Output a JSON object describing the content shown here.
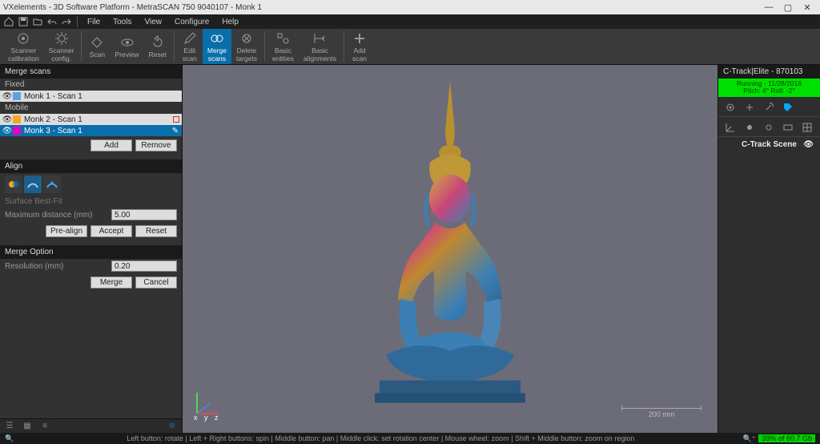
{
  "window": {
    "title": "VXelements - 3D Software Platform - MetraSCAN 750 9040107 - Monk 1",
    "minimize": "—",
    "maximize": "▢",
    "close": "✕"
  },
  "menu": {
    "items": [
      "File",
      "Tools",
      "View",
      "Configure",
      "Help"
    ]
  },
  "ribbon": {
    "scanner_calibration": "Scanner\ncalibration",
    "scanner_config": "Scanner\nconfig.",
    "scan": "Scan",
    "preview": "Preview",
    "reset": "Reset",
    "edit_scan": "Edit\nscan",
    "merge_scans": "Merge\nscans",
    "delete_targets": "Delete\ntargets",
    "basic_entities": "Basic\nentities",
    "basic_alignments": "Basic\nalignments",
    "add_scan": "Add\nscan"
  },
  "merge_panel": {
    "header": "Merge scans",
    "fixed_label": "Fixed",
    "mobile_label": "Mobile",
    "fixed_items": [
      {
        "swatch": "#5aa0e6",
        "label": "Monk 1 - Scan 1"
      }
    ],
    "mobile_items": [
      {
        "swatch": "#f5a623",
        "label": "Monk 2 - Scan 1",
        "selected": false
      },
      {
        "swatch": "#e400c8",
        "label": "Monk 3 - Scan 1",
        "selected": true
      }
    ],
    "add_btn": "Add",
    "remove_btn": "Remove",
    "align_header": "Align",
    "surface_best_fit": "Surface Best-Fit",
    "max_distance_label": "Maximum distance (mm)",
    "max_distance_value": "5.00",
    "prealign_btn": "Pre-align",
    "accept_btn": "Accept",
    "reset_btn": "Reset",
    "merge_option_header": "Merge Option",
    "resolution_label": "Resolution (mm)",
    "resolution_value": "0.20",
    "merge_btn": "Merge",
    "cancel_btn": "Cancel"
  },
  "viewport": {
    "scale_label": "200 mm",
    "axis_label": "x y z"
  },
  "tracker": {
    "header": "C-Track|Elite - 870103",
    "status_line1": "Running - 11/28/2018",
    "status_line2": "Pitch: 4°  Roll: -2°",
    "scene_label": "C-Track Scene"
  },
  "statusbar": {
    "hints": "Left button: rotate  |  Left + Right buttons: spin  |  Middle button: pan  |  Middle click: set rotation center  |  Mouse wheel: zoom  |  Shift + Middle button: zoom on region",
    "perf": "39% of 60.7 Gb"
  }
}
